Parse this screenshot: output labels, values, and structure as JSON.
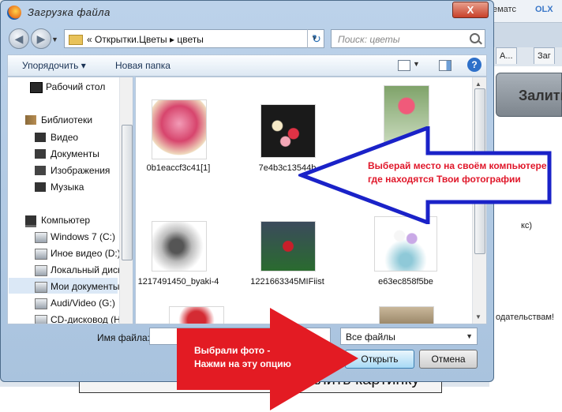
{
  "background": {
    "top_text": "ематс",
    "top_brand": "OLX",
    "tabs": [
      {
        "label": "А..."
      },
      {
        "label": "Заг"
      }
    ],
    "button_label": "Залить",
    "frag1": "кс)",
    "frag2": "одательствам!",
    "bottom_text": "алить картинку"
  },
  "dialog": {
    "title": "Загрузка файла",
    "close_label": "X",
    "nav": {
      "back_label": "◀",
      "forward_label": "▶",
      "address": "« Открытки.Цветы ▸ цветы",
      "search_placeholder": "Поиск: цветы"
    },
    "toolbar": {
      "organize_label": "Упорядочить ▾",
      "new_folder_label": "Новая папка",
      "help_label": "?"
    },
    "sidebar": {
      "items": [
        {
          "label": "Рабочий стол"
        },
        {
          "label": "Библиотеки"
        },
        {
          "label": "Видео"
        },
        {
          "label": "Документы"
        },
        {
          "label": "Изображения"
        },
        {
          "label": "Музыка"
        },
        {
          "label": "Компьютер"
        },
        {
          "label": "Windows 7 (C:)"
        },
        {
          "label": "Иное видео (D:)"
        },
        {
          "label": "Локальный диск"
        },
        {
          "label": "Мои документы"
        },
        {
          "label": "Audi/Video (G:)"
        },
        {
          "label": "CD-дисковод (H"
        }
      ]
    },
    "files": [
      {
        "name": "0b1eaccf3c41[1]"
      },
      {
        "name": "7e4b3c13544b"
      },
      {
        "name": ""
      },
      {
        "name": "1217491450_byaki-4"
      },
      {
        "name": "1221663345MIFiist"
      },
      {
        "name": "e63ec858f5be"
      }
    ],
    "filename_label": "Имя файла:",
    "filename_value": "",
    "filetype_value": "Все файлы",
    "open_label": "Открыть",
    "cancel_label": "Отмена"
  },
  "annotations": {
    "callout1": "Выберай место на своём компьютере где находятся Твои фотографии",
    "callout2_line1": "Выбрали фото -",
    "callout2_line2": "Нажми на эту опцию",
    "arrow1_color": "#1a22c8",
    "arrow2_color": "#e31b23"
  }
}
